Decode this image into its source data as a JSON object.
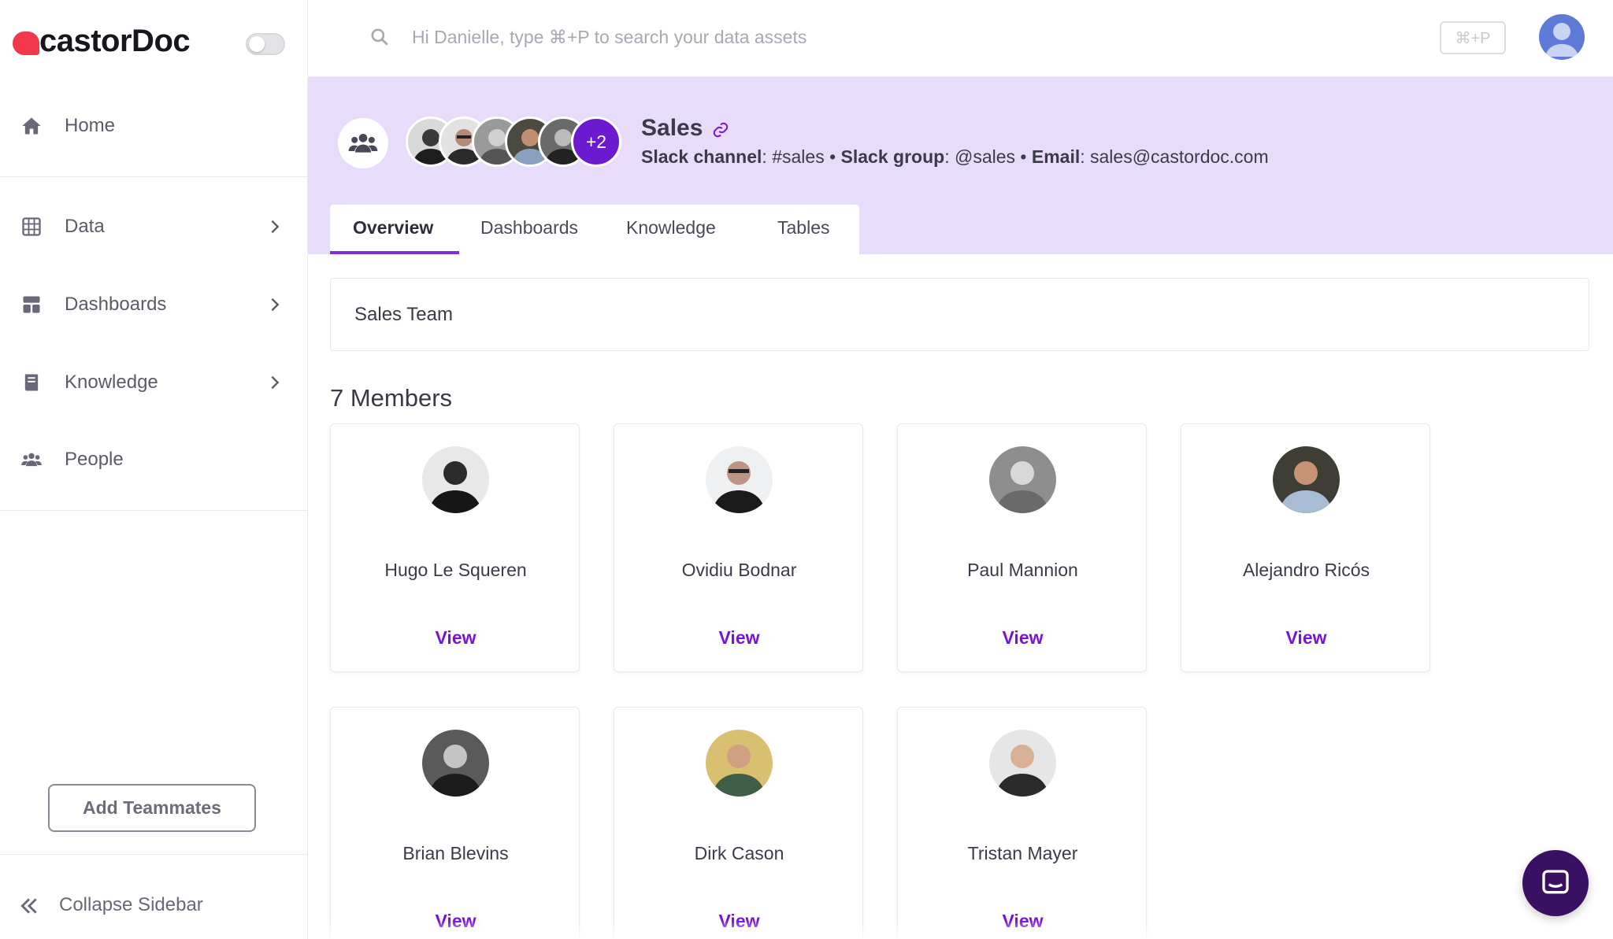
{
  "brand": {
    "name": "castorDoc",
    "accent": "#7a12d8",
    "header_bg": "#e8dcfb"
  },
  "sidebar": {
    "items": [
      {
        "label": "Home",
        "icon": "home-icon"
      },
      {
        "label": "Data",
        "icon": "table-icon"
      },
      {
        "label": "Dashboards",
        "icon": "dashboard-icon"
      },
      {
        "label": "Knowledge",
        "icon": "book-icon"
      },
      {
        "label": "People",
        "icon": "people-icon"
      }
    ],
    "add_button": "Add Teammates",
    "collapse_label": "Collapse Sidebar"
  },
  "search": {
    "placeholder": "Hi Danielle, type ⌘+P to search your data assets",
    "shortcut": "⌘+P"
  },
  "team": {
    "name": "Sales",
    "extra_members": "+2",
    "slack_channel_label": "Slack channel",
    "slack_channel": "#sales",
    "slack_group_label": "Slack group",
    "slack_group": "@sales",
    "email_label": "Email",
    "email": "sales@castordoc.com",
    "description": "Sales Team"
  },
  "tabs": [
    "Overview",
    "Dashboards",
    "Knowledge",
    "Tables"
  ],
  "members_title": "7 Members",
  "members": [
    {
      "name": "Hugo Le Squeren",
      "action": "View"
    },
    {
      "name": "Ovidiu Bodnar",
      "action": "View"
    },
    {
      "name": "Paul Mannion",
      "action": "View"
    },
    {
      "name": "Alejandro Ricós",
      "action": "View"
    },
    {
      "name": "Brian Blevins",
      "action": "View"
    },
    {
      "name": "Dirk Cason",
      "action": "View"
    },
    {
      "name": "Tristan Mayer",
      "action": "View"
    }
  ]
}
